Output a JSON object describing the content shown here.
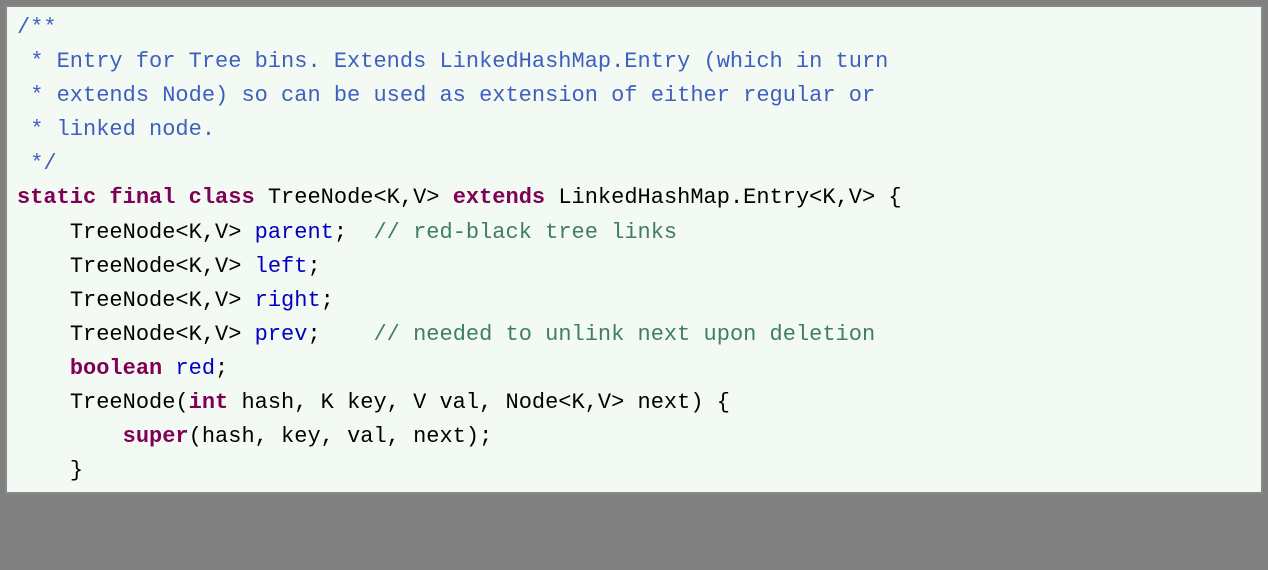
{
  "code": {
    "line1": "/**",
    "line2_prefix": " * ",
    "line2_text": "Entry for Tree bins. Extends LinkedHashMap.Entry (which in turn",
    "line3_prefix": " * ",
    "line3_text": "extends Node) so can be used as extension of either regular or",
    "line4_prefix": " * ",
    "line4_text": "linked node.",
    "line5": " */",
    "l6_kw1": "static",
    "l6_kw2": "final",
    "l6_kw3": "class",
    "l6_type1": "TreeNode<K,V>",
    "l6_kw4": "extends",
    "l6_type2": "LinkedHashMap.Entry<K,V> {",
    "l7_indent": "    ",
    "l7_type": "TreeNode<K,V> ",
    "l7_ident": "parent",
    "l7_semi": ";  ",
    "l7_comment": "// red-black tree links",
    "l8_indent": "    ",
    "l8_type": "TreeNode<K,V> ",
    "l8_ident": "left",
    "l8_semi": ";",
    "l9_indent": "    ",
    "l9_type": "TreeNode<K,V> ",
    "l9_ident": "right",
    "l9_semi": ";",
    "l10_indent": "    ",
    "l10_type": "TreeNode<K,V> ",
    "l10_ident": "prev",
    "l10_semi": ";    ",
    "l10_comment": "// needed to unlink next upon deletion",
    "l11_indent": "    ",
    "l11_kw": "boolean",
    "l11_ident": " red",
    "l11_semi": ";",
    "l12_indent": "    ",
    "l12_type1": "TreeNode(",
    "l12_kw": "int",
    "l12_rest": " hash, K key, V val, Node<K,V> next) {",
    "l13_indent": "        ",
    "l13_kw": "super",
    "l13_rest": "(hash, key, val, next);",
    "l14_indent": "    ",
    "l14_brace": "}"
  }
}
